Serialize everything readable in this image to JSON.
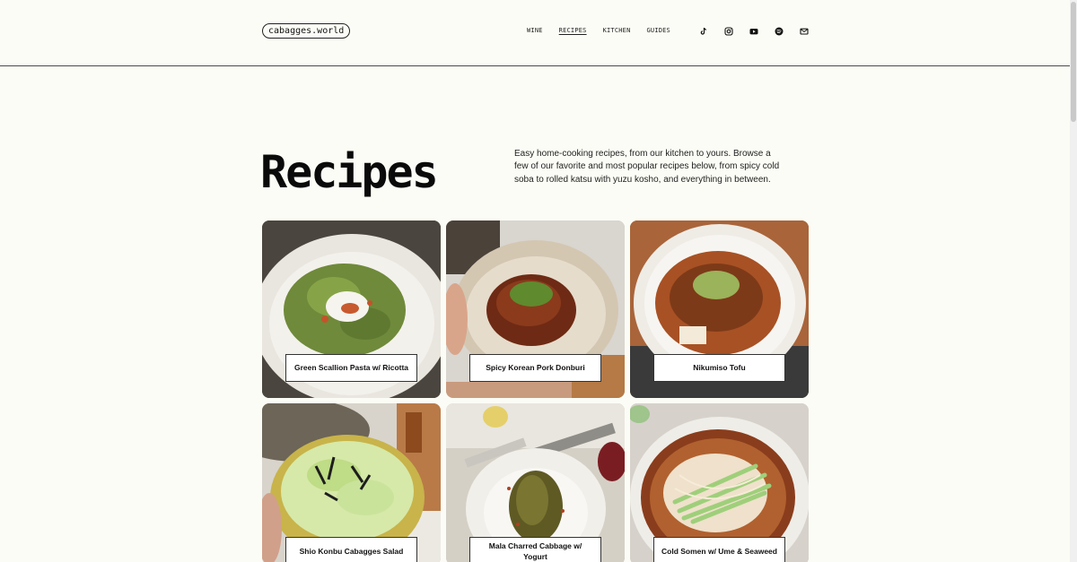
{
  "site": {
    "logo": "cabagges.world"
  },
  "nav": [
    {
      "label": "WINE",
      "active": false
    },
    {
      "label": "RECIPES",
      "active": true
    },
    {
      "label": "KITCHEN",
      "active": false
    },
    {
      "label": "GUIDES",
      "active": false
    }
  ],
  "social": [
    "tiktok-icon",
    "instagram-icon",
    "youtube-icon",
    "spotify-icon",
    "mail-icon"
  ],
  "page": {
    "title": "Recipes",
    "intro": "Easy home-cooking recipes, from our kitchen to yours. Browse a few of our favorite and most popular recipes below, from spicy cold soba to rolled katsu with yuzu kosho, and everything in between."
  },
  "recipes": [
    {
      "title": "Green Scallion Pasta w/ Ricotta"
    },
    {
      "title": "Spicy Korean Pork Donburi"
    },
    {
      "title": "Nikumiso Tofu"
    },
    {
      "title": "Shio Konbu Cabagges Salad"
    },
    {
      "title": "Mala Charred Cabbage w/ Yogurt"
    },
    {
      "title": "Cold Somen w/ Ume & Seaweed"
    }
  ],
  "colors": {
    "background": "#fcfcf6",
    "text": "#111111",
    "divider": "#4a4a4a"
  }
}
